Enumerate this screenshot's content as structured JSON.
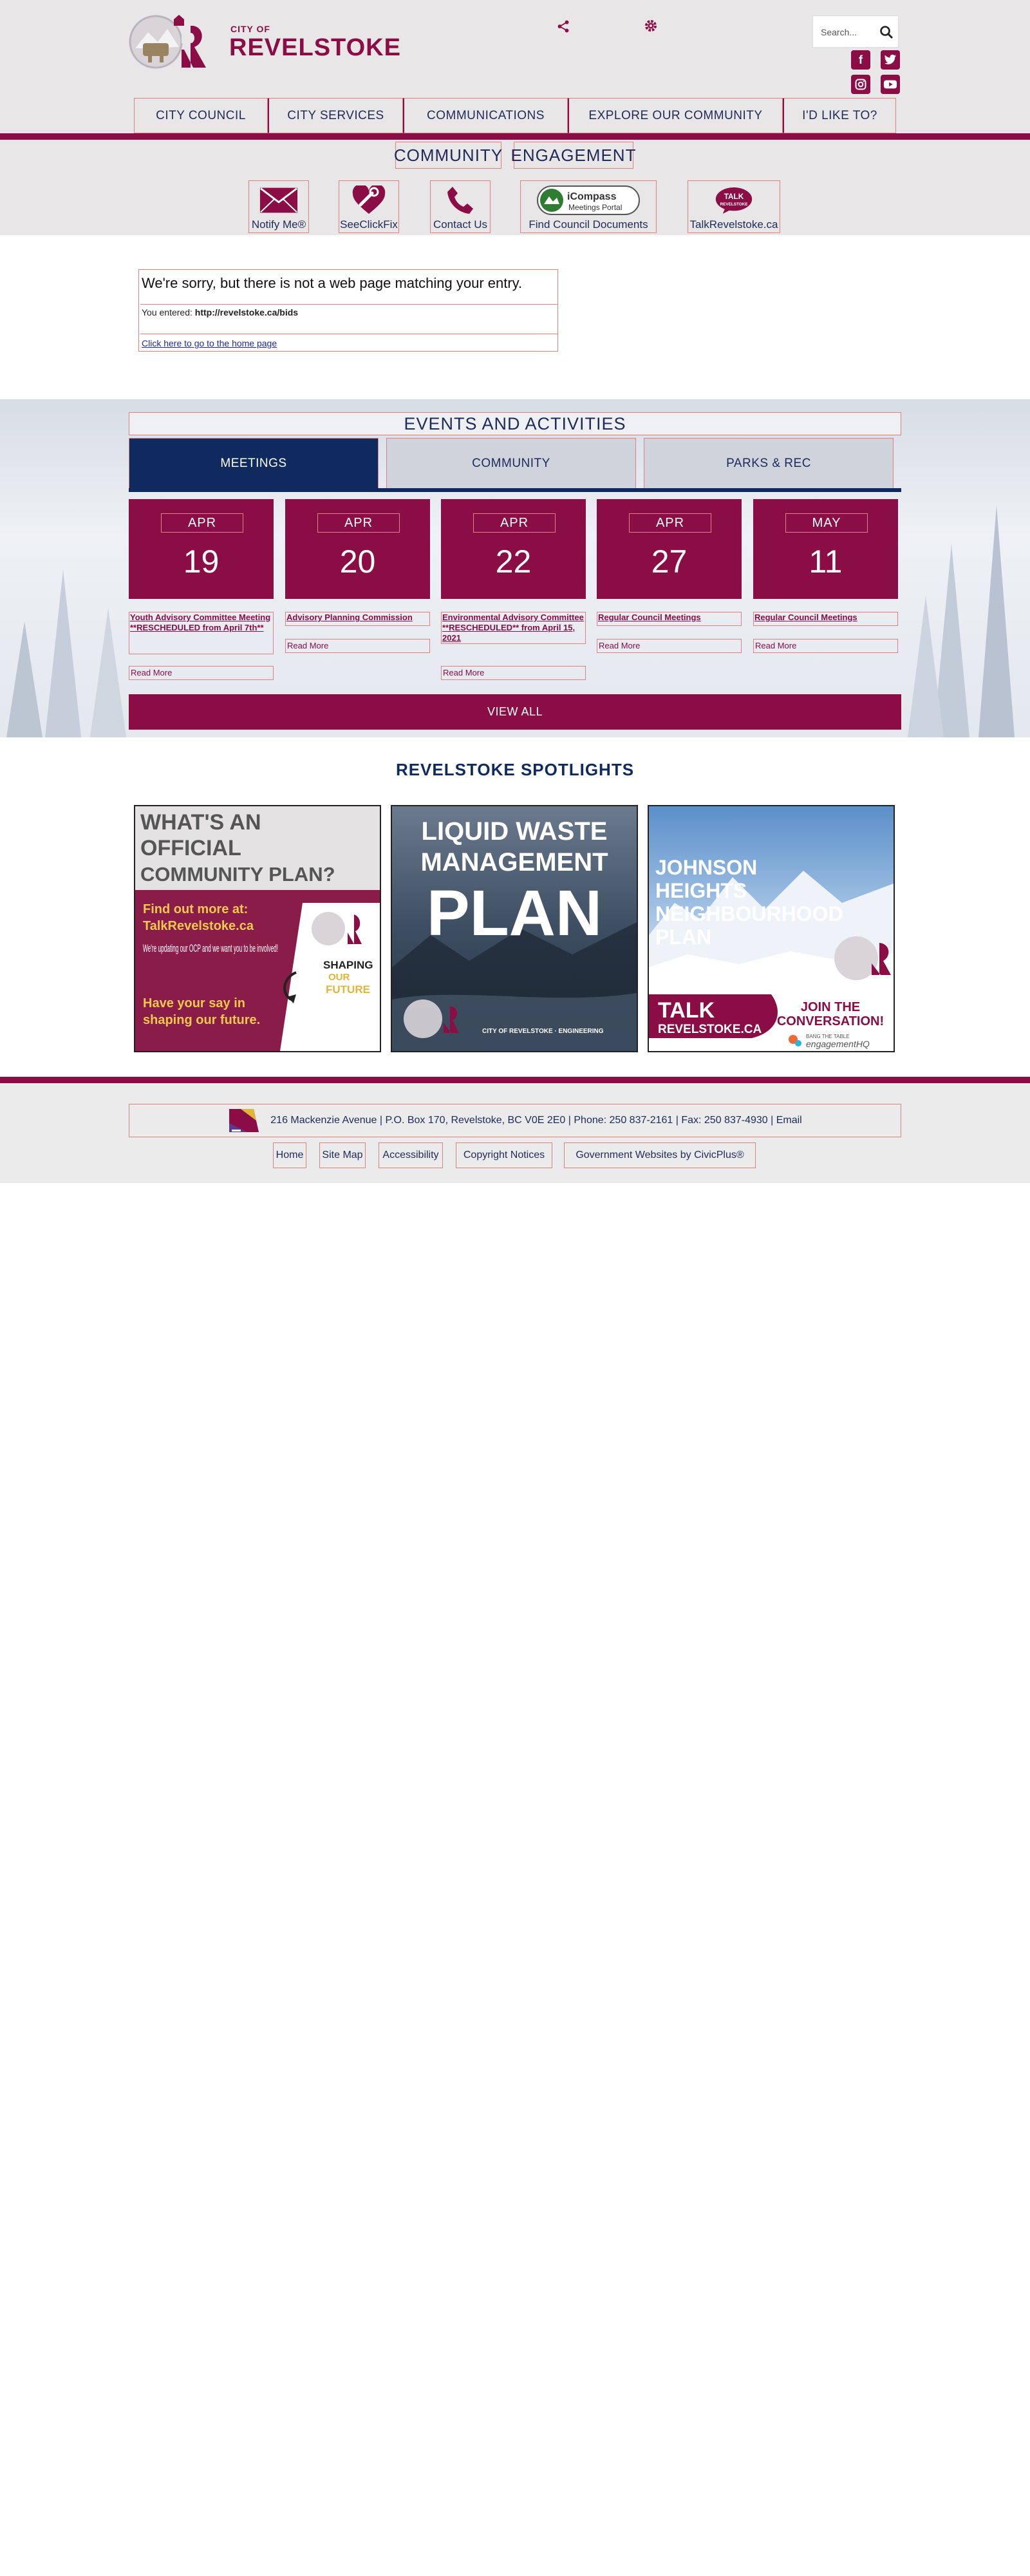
{
  "header": {
    "logo_small": "CITY OF",
    "logo_big": "REVELSTOKE",
    "search_placeholder": "Search...",
    "share_icon": "share-icon",
    "settings_icon": "gear-icon",
    "social": [
      {
        "name": "facebook",
        "glyph": "f"
      },
      {
        "name": "twitter",
        "glyph": "t"
      },
      {
        "name": "instagram",
        "glyph": "◎"
      },
      {
        "name": "youtube",
        "glyph": "▶"
      }
    ]
  },
  "nav": {
    "items": [
      "CITY COUNCIL",
      "CITY SERVICES",
      "COMMUNICATIONS",
      "EXPLORE OUR COMMUNITY",
      "I'D LIKE TO?"
    ]
  },
  "community_engagement": {
    "word1": "COMMUNITY",
    "word2": "ENGAGEMENT"
  },
  "quicklinks": [
    {
      "label": "Notify Me®",
      "icon": "envelope-icon"
    },
    {
      "label": "SeeClickFix",
      "icon": "heart-wrench-icon"
    },
    {
      "label": "Contact Us",
      "icon": "phone-icon"
    },
    {
      "label": "Find Council Documents",
      "icon": "compass-icon",
      "badge_line1": "iCompass",
      "badge_line2": "Meetings Portal"
    },
    {
      "label": "TalkRevelstoke.ca",
      "icon": "talk-icon",
      "badge_line1": "TALK",
      "badge_line2": "REVELSTOKE"
    }
  ],
  "error": {
    "sorry": "We're sorry, but there is not a web page matching your entry.",
    "entered_prefix": "You entered: ",
    "entered_url": "http://revelstoke.ca/bids",
    "home_link": "Click here to go to the home page"
  },
  "events": {
    "title": "EVENTS AND ACTIVITIES",
    "tabs": [
      "MEETINGS",
      "COMMUNITY",
      "PARKS & REC"
    ],
    "active_tab": 0,
    "read_more": "Read More",
    "view_all": "VIEW ALL",
    "items": [
      {
        "month": "APR",
        "day": "19",
        "title": "Youth Advisory Committee Meeting **RESCHEDULED from April 7th**"
      },
      {
        "month": "APR",
        "day": "20",
        "title": "Advisory Planning Commission"
      },
      {
        "month": "APR",
        "day": "22",
        "title": "Environmental Advisory Committee **RESCHEDULED** from April 15, 2021"
      },
      {
        "month": "APR",
        "day": "27",
        "title": "Regular Council Meetings"
      },
      {
        "month": "MAY",
        "day": "11",
        "title": "Regular Council Meetings"
      }
    ]
  },
  "spotlights": {
    "title": "REVELSTOKE SPOTLIGHTS",
    "cards": [
      {
        "headline1": "WHAT'S AN",
        "headline2": "OFFICIAL",
        "headline3": "COMMUNITY PLAN?",
        "find_out": "Find out more at:",
        "site": "TalkRevelstoke.ca",
        "body": "We're updating our OCP and we want you to be involved!",
        "cta1": "Have your say in",
        "cta2": "shaping our future.",
        "logo1": "SHAPING",
        "logo2": "OUR",
        "logo3": "FUTURE"
      },
      {
        "headline1": "LIQUID WASTE",
        "headline2": "MANAGEMENT",
        "headline3": "PLAN",
        "footer": "CITY OF REVELSTOKE · ENGINEERING"
      },
      {
        "headline1": "JOHNSON",
        "headline2": "HEIGHTS",
        "headline3": "NEIGHBOURHOOD",
        "headline4": "PLAN",
        "talk1": "TALK",
        "talk2": "REVELSTOKE.CA",
        "join1": "JOIN THE",
        "join2": "CONVERSATION!",
        "bang": "BANG THE TABLE",
        "ehq": "engagementHQ"
      }
    ]
  },
  "footer": {
    "address": "216 Mackenzie Avenue | P.O. Box 170, Revelstoke, BC V0E 2E0 | Phone: 250 837-2161 | Fax: 250 837-4930 | Email",
    "links": [
      "Home",
      "Site Map",
      "Accessibility",
      "Copyright Notices",
      "Government Websites by CivicPlus®"
    ]
  },
  "colors": {
    "maroon": "#8a0d45",
    "navy": "#0e2a5e",
    "header_bg": "#e8e6e7"
  }
}
